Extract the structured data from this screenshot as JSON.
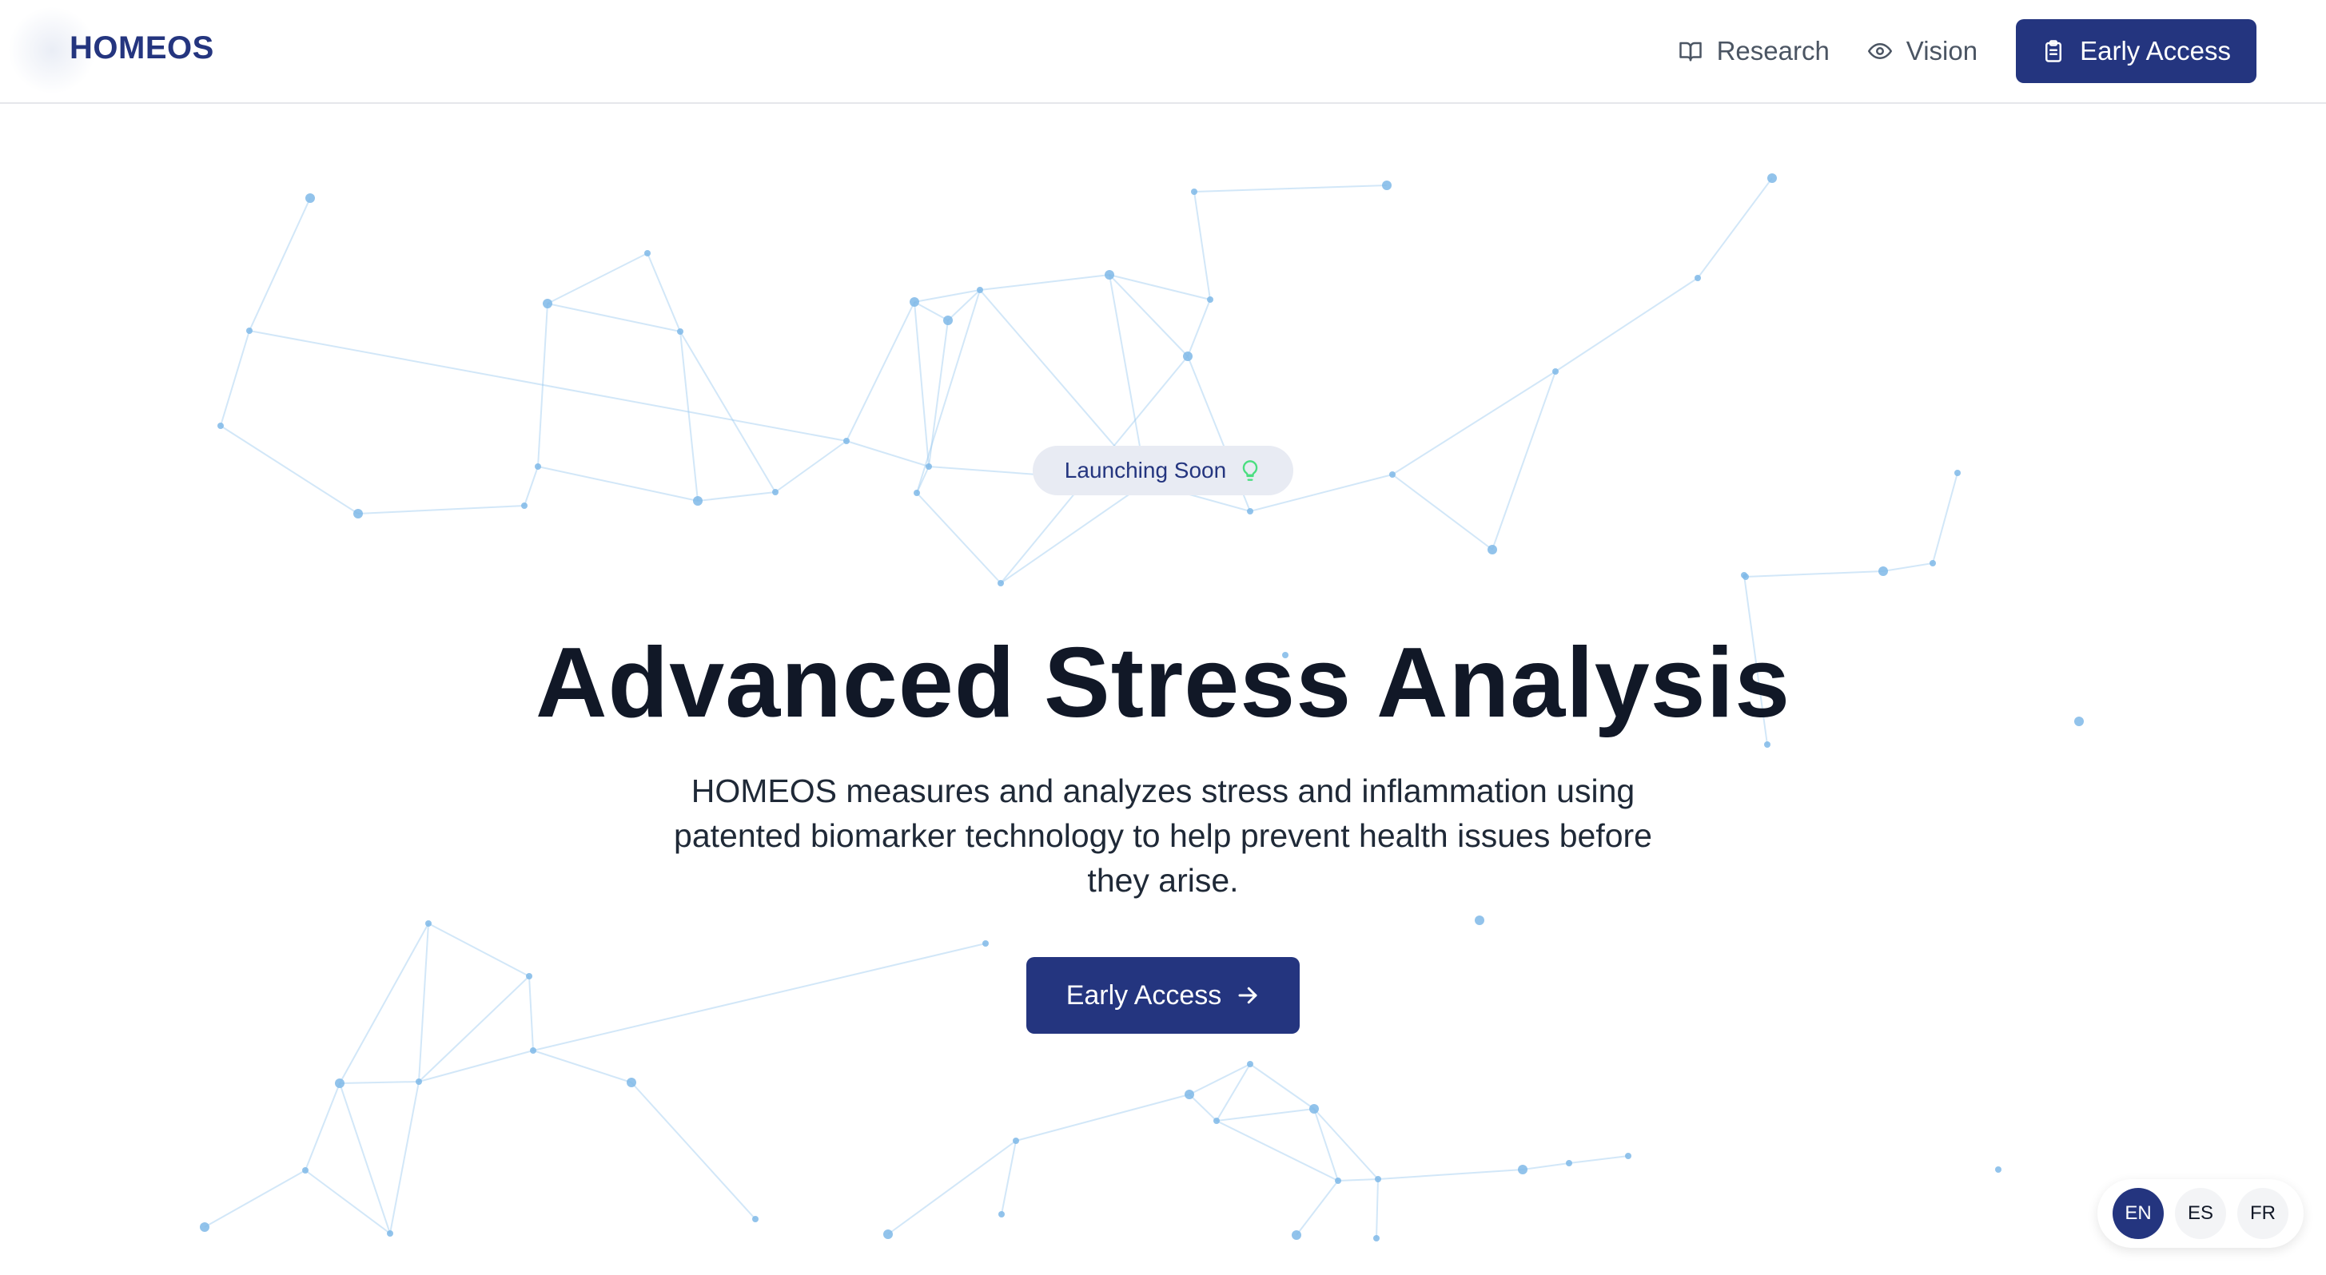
{
  "header": {
    "logo": "HOMEOS",
    "nav": [
      {
        "label": "Research",
        "icon": "book-open-icon"
      },
      {
        "label": "Vision",
        "icon": "eye-icon"
      }
    ],
    "cta": {
      "label": "Early Access",
      "icon": "clipboard-icon"
    }
  },
  "hero": {
    "badge": {
      "label": "Launching Soon",
      "icon": "lightbulb-icon"
    },
    "title": "Advanced Stress Analysis",
    "subtitle": "HOMEOS measures and analyzes stress and inflammation using patented biomarker technology to help prevent health issues before they arise.",
    "cta": {
      "label": "Early Access",
      "icon": "arrow-right-icon"
    }
  },
  "language_switcher": {
    "options": [
      "EN",
      "ES",
      "FR"
    ],
    "selected": "EN"
  },
  "colors": {
    "brand": "#24357f",
    "network_line": "#9cc9ef",
    "network_node": "#7fb8e8",
    "badge_bg": "#e8ebf3",
    "bulb": "#4ade80"
  }
}
